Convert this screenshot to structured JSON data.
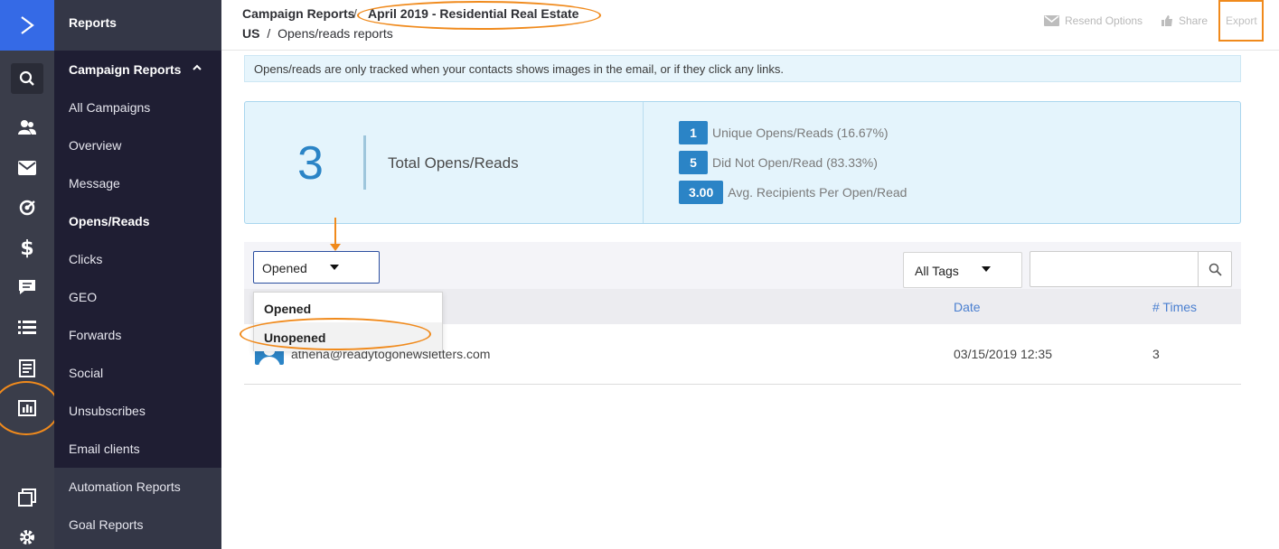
{
  "rail": {
    "icons": [
      "logo-chevron-icon",
      "search-icon",
      "contacts-icon",
      "campaigns-icon",
      "automations-icon",
      "deals-icon",
      "conversations-icon",
      "lists-icon",
      "forms-icon",
      "reports-icon",
      "apps-icon",
      "settings-icon"
    ]
  },
  "nav": {
    "header": "Reports",
    "section": "Campaign Reports",
    "items": [
      "All Campaigns",
      "Overview",
      "Message",
      "Opens/Reads",
      "Clicks",
      "GEO",
      "Forwards",
      "Social",
      "Unsubscribes",
      "Email clients"
    ],
    "active": "Opens/Reads",
    "lower_items": [
      "Automation Reports",
      "Goal Reports"
    ]
  },
  "header": {
    "crumb_root": "Campaign Reports",
    "crumb_sep": "/",
    "crumb_campaign": "April 2019 - Residential Real Estate",
    "crumb_sub_bold": "US",
    "crumb_sub_sep": "/",
    "crumb_sub": "Opens/reads reports",
    "resend": "Resend Options",
    "share": "Share",
    "export": "Export"
  },
  "info": "Opens/reads are only tracked when your contacts shows images in the email, or if they click any links.",
  "stats": {
    "total_value": "3",
    "total_label": "Total Opens/Reads",
    "rows": [
      {
        "value": "1",
        "label": "Unique Opens/Reads (16.67%)"
      },
      {
        "value": "5",
        "label": "Did Not Open/Read (83.33%)"
      },
      {
        "value": "3.00",
        "label": "Avg. Recipients Per Open/Read"
      }
    ]
  },
  "filters": {
    "status_selected": "Opened",
    "status_options": [
      "Opened",
      "Unopened"
    ],
    "tags_selected": "All Tags",
    "search_value": ""
  },
  "table": {
    "headers": {
      "date": "Date",
      "times": "# Times"
    },
    "rows": [
      {
        "email": "athena@readytogonewsletters.com",
        "date": "03/15/2019 12:35",
        "times": "3"
      }
    ]
  },
  "colors": {
    "accent": "#2b84c6",
    "highlight": "#f08a1c",
    "rail": "#3a3d4a",
    "nav": "#1f1e33",
    "logo": "#356ae6"
  }
}
